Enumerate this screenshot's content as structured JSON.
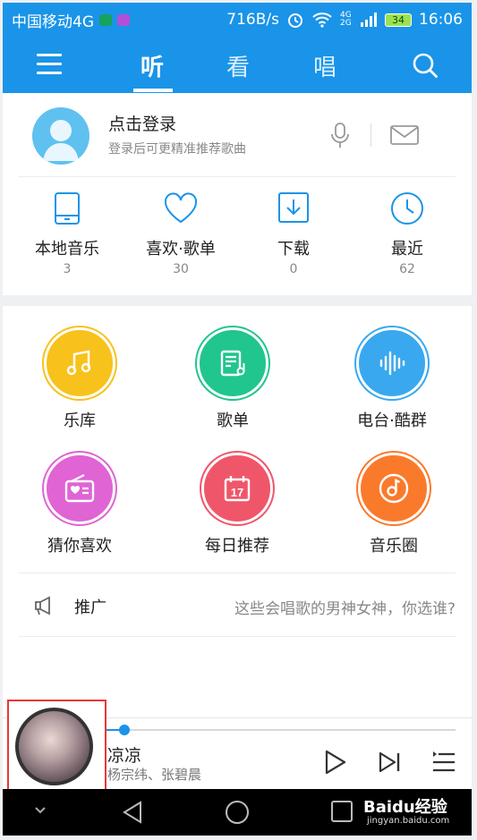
{
  "status_bar": {
    "carrier": "中国移动4G",
    "net_speed": "716B/s",
    "signal_label": "4G 2G",
    "battery": "34",
    "time": "16:06"
  },
  "top_nav": {
    "tabs": [
      {
        "label": "听",
        "active": true
      },
      {
        "label": "看",
        "active": false
      },
      {
        "label": "唱",
        "active": false
      }
    ],
    "accent_color": "#1a94e8"
  },
  "profile": {
    "login_title": "点击登录",
    "login_subtitle": "登录后可更精准推荐歌曲"
  },
  "stats": [
    {
      "label": "本地音乐",
      "count": "3",
      "icon": "phone-icon"
    },
    {
      "label": "喜欢·歌单",
      "count": "30",
      "icon": "heart-icon"
    },
    {
      "label": "下载",
      "count": "0",
      "icon": "download-icon"
    },
    {
      "label": "最近",
      "count": "62",
      "icon": "clock-icon"
    }
  ],
  "grid": [
    {
      "label": "乐库",
      "icon": "music-note-icon",
      "color": "#f8c21c"
    },
    {
      "label": "歌单",
      "icon": "playlist-icon",
      "color": "#21c58e"
    },
    {
      "label": "电台·酷群",
      "icon": "sound-wave-icon",
      "color": "#3aa8ee"
    },
    {
      "label": "猜你喜欢",
      "icon": "radio-heart-icon",
      "color": "#e064d4"
    },
    {
      "label": "每日推荐",
      "icon": "calendar-icon",
      "color": "#f0566a",
      "badge": "17"
    },
    {
      "label": "音乐圈",
      "icon": "disc-icon",
      "color": "#fa7a2c"
    }
  ],
  "promo": {
    "label": "推广",
    "text": "这些会唱歌的男神女神，你选谁?"
  },
  "player": {
    "song_title": "凉凉",
    "artist": "杨宗纬、张碧晨",
    "progress": 0.05
  },
  "watermark": {
    "brand": "Baidu经验",
    "url": "jingyan.baidu.com"
  }
}
